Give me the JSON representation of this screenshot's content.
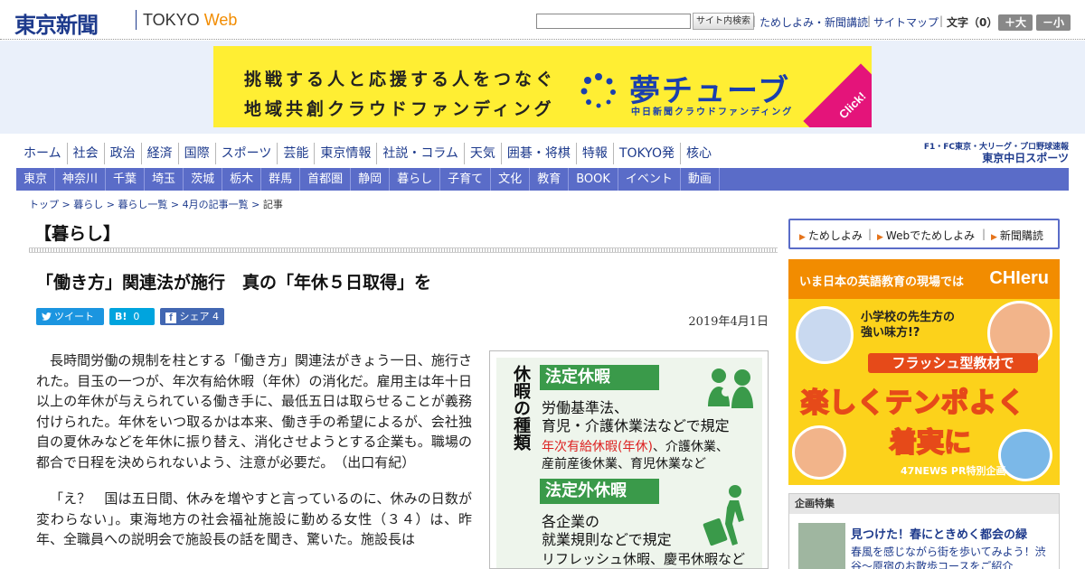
{
  "header": {
    "logo": "東京新聞",
    "logo_sub_plain": "TOKYO ",
    "logo_sub_accent": "Web",
    "search_placeholder": "",
    "search_button": "サイト内検索",
    "links": [
      "ためしよみ・新聞講読",
      "サイトマップ"
    ],
    "font_size_label": "文字（0）",
    "font_bigger": "＋大",
    "font_smaller": "－小"
  },
  "ad_banner": {
    "line1": "挑戦する人と応援する人をつなぐ",
    "line2": "地域共創クラウドファンディング",
    "brand": "夢チューブ",
    "brand_sub": "中日新聞クラウドファンディング",
    "click": "Click!"
  },
  "nav": {
    "main": [
      "ホーム",
      "社会",
      "政治",
      "経済",
      "国際",
      "スポーツ",
      "芸能",
      "東京情報",
      "社説・コラム",
      "天気",
      "囲碁・将棋",
      "特報",
      "TOKYO発",
      "核心"
    ],
    "region": [
      "東京",
      "神奈川",
      "千葉",
      "埼玉",
      "茨城",
      "栃木",
      "群馬",
      "首都圏",
      "静岡",
      "暮らし",
      "子育て",
      "文化",
      "教育",
      "BOOK",
      "イベント",
      "動画"
    ],
    "sports_top": "F1・FC東京・大リーグ・プロ野球速報",
    "sports_name": "東京中日スポーツ"
  },
  "breadcrumb": {
    "items": [
      "トップ",
      "暮らし",
      "暮らし一覧",
      "4月の記事一覧"
    ],
    "current": "記事",
    "sep": " > "
  },
  "section_title": "【暮らし】",
  "article": {
    "title": "「働き方」関連法が施行　真の「年休５日取得」を",
    "date": "2019年4月1日",
    "share": {
      "twitter": "ツイート",
      "hatena_label": "B!",
      "hatena_count": "0",
      "facebook_label": "シェア",
      "facebook_count": "4"
    },
    "paragraphs": [
      "長時間労働の規制を柱とする「働き方」関連法がきょう一日、施行された。目玉の一つが、年次有給休暇（年休）の消化だ。雇用主は年十日以上の年休が与えられている働き手に、最低五日は取らせることが義務付けられた。年休をいつ取るかは本来、働き手の希望によるが、会社独自の夏休みなどを年休に振り替え、消化させようとする企業も。職場の都合で日程を決められないよう、注意が必要だ。　（出口有紀）",
      "「え？　国は五日間、休みを増やすと言っているのに、休みの日数が変わらない」。東海地方の社会福祉施設に勤める女性（３４）は、昨年、全職員への説明会で施設長の話を聞き、驚いた。施設長は"
    ],
    "figure": {
      "vertical_title": "休暇の種類",
      "statutory_head": "法定休暇",
      "statutory_lines": [
        "労働基準法、",
        "育児・介護休業法などで規定"
      ],
      "statutory_red": "年次有給休暇(年休)",
      "statutory_rest": "、介護休業、",
      "statutory_line4": "産前産後休業、育児休業など",
      "nonstatutory_head": "法定外休暇",
      "nonstatutory_lines": [
        "各企業の",
        "就業規則などで規定"
      ],
      "nonstatutory_line3": "リフレッシュ休暇、慶弔休暇など"
    }
  },
  "sidebar": {
    "buttons": [
      "ためしよみ",
      "Webでためしよみ",
      "新聞購読"
    ],
    "ad": {
      "top": "いま日本の英語教育の現場では",
      "brand": "CHIeru",
      "sub1": "小学校の先生方の",
      "sub2": "強い味方!?",
      "flash": "フラッシュ型教材で",
      "main1": "楽しくテンポよく",
      "main2": "着実に",
      "foot": "47NEWS PR特別企画"
    },
    "feature": {
      "head": "企画特集",
      "title": "見つけた！春にときめく都会の緑",
      "desc": "春風を感じながら街を歩いてみよう！渋谷～原宿のお散歩コースをご紹介"
    }
  },
  "colors": {
    "brand_blue": "#1d3a8c",
    "region_nav": "#5a6cc8",
    "accent_orange": "#f28c00",
    "ad_yellow": "#ffee33",
    "figure_green": "#3a9a4a"
  }
}
